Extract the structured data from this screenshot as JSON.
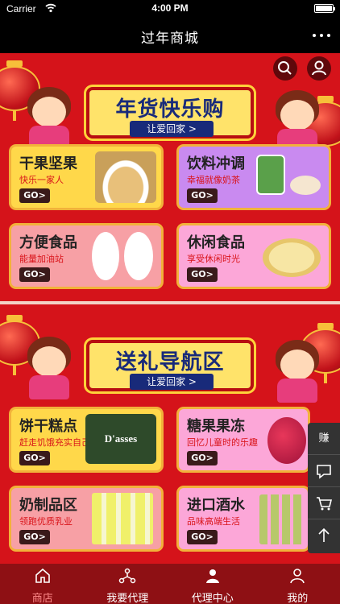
{
  "status_bar": {
    "carrier": "Carrier",
    "time": "4:00 PM"
  },
  "nav": {
    "title": "过年商城"
  },
  "section1": {
    "banner_title": "年货快乐购",
    "banner_sub": "让爱回家 >",
    "cards": [
      {
        "title": "干果坚果",
        "subtitle": "快乐一家人",
        "go": "GO>"
      },
      {
        "title": "饮料冲调",
        "subtitle": "幸福就像奶茶",
        "go": "GO>"
      },
      {
        "title": "方便食品",
        "subtitle": "能量加油站",
        "go": "GO>"
      },
      {
        "title": "休闲食品",
        "subtitle": "享受休闲时光",
        "go": "GO>"
      }
    ]
  },
  "section2": {
    "banner_title": "送礼导航区",
    "banner_sub": "让爱回家 >",
    "cards": [
      {
        "title": "饼干糕点",
        "subtitle": "赶走饥饿充实自己",
        "go": "GO>",
        "product_text": "D'asses"
      },
      {
        "title": "糖果果冻",
        "subtitle": "回忆儿童时的乐趣",
        "go": "GO>"
      },
      {
        "title": "奶制品区",
        "subtitle": "领跑优质乳业",
        "go": "GO>"
      },
      {
        "title": "进口酒水",
        "subtitle": "品味高端生活",
        "go": "GO>"
      }
    ]
  },
  "float_bar": {
    "earn": "赚"
  },
  "tabs": [
    {
      "label": "商店",
      "icon": "home-icon"
    },
    {
      "label": "我要代理",
      "icon": "network-icon"
    },
    {
      "label": "代理中心",
      "icon": "agent-icon"
    },
    {
      "label": "我的",
      "icon": "user-icon"
    }
  ],
  "colors": {
    "nav_bg": "#000000",
    "section_bg": "#d5131a",
    "tab_bar_bg": "#8e1014",
    "banner_text": "#182a7a"
  }
}
